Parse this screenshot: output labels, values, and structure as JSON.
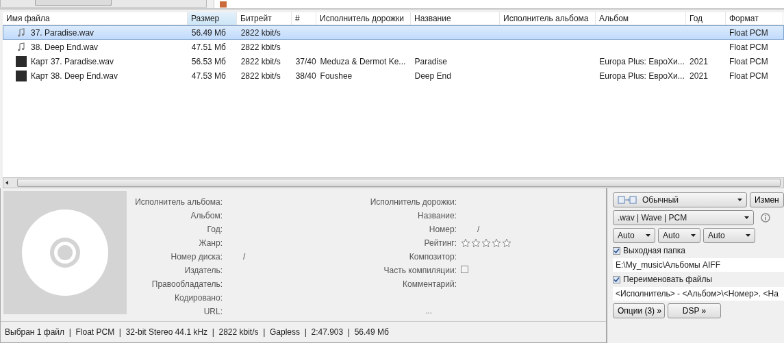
{
  "columns": [
    {
      "label": "Имя файла",
      "sorted": false
    },
    {
      "label": "Размер",
      "sorted": true
    },
    {
      "label": "Битрейт",
      "sorted": false
    },
    {
      "label": "#",
      "sorted": false
    },
    {
      "label": "Исполнитель дорожки",
      "sorted": false
    },
    {
      "label": "Название",
      "sorted": false
    },
    {
      "label": "Исполнитель альбома",
      "sorted": false
    },
    {
      "label": "Альбом",
      "sorted": false
    },
    {
      "label": "Год",
      "sorted": false
    },
    {
      "label": "Формат",
      "sorted": false
    }
  ],
  "rows": [
    {
      "kind": "audio",
      "selected": true,
      "cells": [
        "37. Paradise.wav",
        "56.49 Мб",
        "2822 kbit/s",
        "",
        "",
        "",
        "",
        "",
        "",
        "Float PCM"
      ]
    },
    {
      "kind": "audio",
      "selected": false,
      "cells": [
        "38. Deep End.wav",
        "47.51 Мб",
        "2822 kbit/s",
        "",
        "",
        "",
        "",
        "",
        "",
        "Float PCM"
      ]
    },
    {
      "kind": "art",
      "selected": false,
      "cells": [
        "Карт 37. Paradise.wav",
        "56.53 Мб",
        "2822 kbit/s",
        "37/40",
        "Meduza & Dermot Ke...",
        "Paradise",
        "",
        "Europa Plus: ЕвроХи...",
        "2021",
        "Float PCM"
      ]
    },
    {
      "kind": "art",
      "selected": false,
      "cells": [
        "Карт 38. Deep End.wav",
        "47.53 Мб",
        "2822 kbit/s",
        "38/40",
        "Foushee",
        "Deep End",
        "",
        "Europa Plus: ЕвроХи...",
        "2021",
        "Float PCM"
      ]
    }
  ],
  "info_left": [
    {
      "kind": "text",
      "label": "Исполнитель альбома:"
    },
    {
      "kind": "text",
      "label": "Альбом:"
    },
    {
      "kind": "text",
      "label": "Год:"
    },
    {
      "kind": "text",
      "label": "Жанр:"
    },
    {
      "kind": "text",
      "label": "Номер диска:",
      "value": "/"
    },
    {
      "kind": "text",
      "label": "Издатель:"
    },
    {
      "kind": "text",
      "label": "Правообладатель:"
    },
    {
      "kind": "text",
      "label": "Кодировано:"
    },
    {
      "kind": "text",
      "label": "URL:"
    }
  ],
  "info_right": [
    {
      "kind": "text",
      "label": "Исполнитель дорожки:"
    },
    {
      "kind": "text",
      "label": "Название:"
    },
    {
      "kind": "text",
      "label": "Номер:",
      "value": "/"
    },
    {
      "kind": "rating",
      "label": "Рейтинг:",
      "stars": 0
    },
    {
      "kind": "text",
      "label": "Композитор:"
    },
    {
      "kind": "check",
      "label": "Часть компиляции:",
      "checked": false
    },
    {
      "kind": "text",
      "label": "Комментарий:"
    }
  ],
  "more": "...",
  "status_bar": "Выбран 1 файл  |  Float PCM  |  32-bit Stereo 44.1 kHz  |  2822 kbit/s  |  Gapless  |  2:47.903  |  56.49 Мб",
  "converter": {
    "mode": "Обычный",
    "change_button": "Измен",
    "format": ".wav | Wave | PCM",
    "autos": [
      "Auto",
      "Auto",
      "Auto"
    ],
    "output_folder": {
      "label": "Выходная папка",
      "checked": true,
      "value": "E:\\My_music\\Альбомы AIFF"
    },
    "rename": {
      "label": "Переименовать файлы",
      "checked": true,
      "value": "<Исполнитель> - <Альбом>\\<Номер>. <На"
    },
    "buttons": [
      "Опции (3) »",
      "DSP »"
    ]
  }
}
